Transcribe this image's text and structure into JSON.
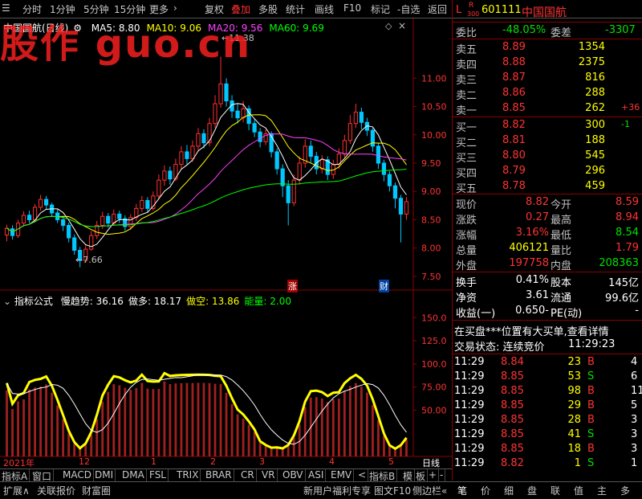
{
  "toolbar": {
    "left_items": [
      "分时",
      "1分钟",
      "5分钟",
      "15分钟",
      "更多"
    ],
    "right_items": [
      "复权",
      "叠加",
      "多股",
      "统计",
      "画线",
      "F10",
      "标记",
      "-自选",
      "返回"
    ],
    "active": "叠加"
  },
  "watermark": "股作 guo.cn",
  "kline": {
    "title": "中国国航(日线)",
    "ma_labels": [
      {
        "text": "MA5: 8.80",
        "color": "#ffffff"
      },
      {
        "text": "MA10: 9.06",
        "color": "#ffff00"
      },
      {
        "text": "MA20: 9.56",
        "color": "#ff40ff"
      },
      {
        "text": "MA60: 9.69",
        "color": "#00ff00"
      }
    ],
    "high_label": "11.38",
    "low_label": "7.66",
    "y_ticks": [
      "11.00",
      "10.50",
      "10.00",
      "9.50",
      "9.00",
      "8.50",
      "8.00",
      "7.50"
    ],
    "marker_zhang": "涨",
    "marker_cai": "财"
  },
  "indicator": {
    "title": "指标公式",
    "labels": [
      {
        "text": "慢趋势: 36.16",
        "color": "#ffffff"
      },
      {
        "text": "做多: 18.17",
        "color": "#ffffff"
      },
      {
        "text": "做空: 13.86",
        "color": "#ffff00"
      },
      {
        "text": "能量: 2.00",
        "color": "#00ff00"
      }
    ],
    "y_ticks": [
      "150.0",
      "125.0",
      "100.0",
      "75.00",
      "50.00"
    ]
  },
  "x_axis": {
    "labels": [
      "2021年",
      "12",
      "1",
      "2",
      "3",
      "4",
      "5"
    ],
    "period": "日线"
  },
  "chart_data": {
    "type": "line",
    "title": "",
    "candles": [
      [
        8.23,
        8.35,
        8.12,
        8.41
      ],
      [
        8.34,
        8.22,
        8.15,
        8.4
      ],
      [
        8.22,
        8.44,
        8.18,
        8.5
      ],
      [
        8.44,
        8.58,
        8.38,
        8.65
      ],
      [
        8.58,
        8.5,
        8.44,
        8.66
      ],
      [
        8.5,
        8.72,
        8.45,
        8.78
      ],
      [
        8.72,
        8.86,
        8.66,
        8.94
      ],
      [
        8.86,
        8.76,
        8.68,
        8.92
      ],
      [
        8.76,
        8.62,
        8.55,
        8.8
      ],
      [
        8.62,
        8.5,
        8.44,
        8.68
      ],
      [
        8.5,
        8.4,
        8.3,
        8.56
      ],
      [
        8.4,
        8.18,
        8.1,
        8.45
      ],
      [
        8.18,
        7.96,
        7.88,
        8.24
      ],
      [
        7.96,
        7.78,
        7.66,
        8.02
      ],
      [
        7.78,
        7.98,
        7.74,
        8.05
      ],
      [
        7.98,
        8.22,
        7.95,
        8.3
      ],
      [
        8.22,
        8.4,
        8.16,
        8.48
      ],
      [
        8.4,
        8.56,
        8.34,
        8.64
      ],
      [
        8.56,
        8.44,
        8.36,
        8.62
      ],
      [
        8.44,
        8.6,
        8.4,
        8.68
      ],
      [
        8.6,
        8.52,
        8.44,
        8.66
      ],
      [
        8.52,
        8.38,
        8.3,
        8.58
      ],
      [
        8.38,
        8.54,
        8.32,
        8.6
      ],
      [
        8.54,
        8.7,
        8.48,
        8.78
      ],
      [
        8.7,
        8.84,
        8.64,
        8.92
      ],
      [
        8.84,
        8.7,
        8.62,
        8.9
      ],
      [
        8.7,
        8.92,
        8.66,
        9.0
      ],
      [
        8.92,
        9.2,
        8.86,
        9.3
      ],
      [
        9.2,
        9.36,
        9.1,
        9.46
      ],
      [
        9.36,
        9.22,
        9.12,
        9.44
      ],
      [
        9.22,
        9.48,
        9.18,
        9.58
      ],
      [
        9.48,
        9.7,
        9.4,
        9.8
      ],
      [
        9.7,
        9.58,
        9.48,
        9.82
      ],
      [
        9.58,
        9.8,
        9.52,
        9.9
      ],
      [
        9.8,
        10.02,
        9.72,
        10.12
      ],
      [
        10.02,
        9.86,
        9.76,
        10.1
      ],
      [
        9.86,
        10.2,
        9.8,
        10.3
      ],
      [
        10.2,
        10.55,
        10.12,
        10.7
      ],
      [
        10.55,
        10.9,
        10.48,
        11.38
      ],
      [
        10.9,
        10.6,
        10.5,
        11.0
      ],
      [
        10.6,
        10.42,
        10.3,
        10.7
      ],
      [
        10.42,
        10.3,
        10.2,
        10.55
      ],
      [
        10.3,
        10.46,
        10.22,
        10.6
      ],
      [
        10.46,
        10.2,
        10.08,
        10.52
      ],
      [
        10.2,
        10.05,
        9.96,
        10.28
      ],
      [
        10.05,
        9.88,
        9.78,
        10.12
      ],
      [
        9.88,
        10.02,
        9.82,
        10.1
      ],
      [
        10.02,
        9.7,
        9.6,
        10.06
      ],
      [
        9.7,
        9.4,
        9.3,
        9.76
      ],
      [
        9.4,
        9.1,
        8.9,
        9.48
      ],
      [
        9.1,
        8.8,
        8.4,
        9.2
      ],
      [
        8.8,
        9.2,
        8.74,
        9.3
      ],
      [
        9.2,
        9.5,
        9.12,
        9.62
      ],
      [
        9.5,
        9.8,
        9.42,
        9.92
      ],
      [
        9.8,
        9.62,
        9.5,
        9.9
      ],
      [
        9.62,
        9.4,
        9.3,
        9.7
      ],
      [
        9.4,
        9.56,
        9.32,
        9.64
      ],
      [
        9.56,
        9.3,
        9.2,
        9.62
      ],
      [
        9.3,
        9.48,
        9.22,
        9.56
      ],
      [
        9.48,
        9.66,
        9.4,
        9.76
      ],
      [
        9.66,
        9.9,
        9.6,
        10.0
      ],
      [
        9.9,
        10.2,
        9.84,
        10.35
      ],
      [
        10.2,
        10.4,
        10.12,
        10.55
      ],
      [
        10.4,
        10.22,
        10.1,
        10.48
      ],
      [
        10.22,
        10.08,
        9.98,
        10.3
      ],
      [
        10.08,
        9.8,
        9.7,
        10.12
      ],
      [
        9.8,
        9.5,
        9.4,
        9.86
      ],
      [
        9.5,
        9.3,
        9.18,
        9.56
      ],
      [
        9.3,
        9.1,
        9.0,
        9.36
      ],
      [
        9.1,
        8.88,
        8.7,
        9.16
      ],
      [
        8.88,
        8.6,
        8.1,
        8.94
      ],
      [
        8.6,
        8.82,
        8.5,
        8.9
      ]
    ],
    "y_range": [
      7.3,
      11.8
    ],
    "indicator_range": [
      0,
      165
    ]
  },
  "quote": {
    "stock_code": "601111",
    "stock_name": "中国国航",
    "badge_l": "L",
    "badge_r": "R",
    "badge_300": "300",
    "weibi_label": "委比",
    "weibi_value": "-48.05%",
    "weicha_label": "委差",
    "weicha_value": "-3307",
    "sell": [
      {
        "label": "卖五",
        "price": "8.89",
        "vol": "1354",
        "chg": ""
      },
      {
        "label": "卖四",
        "price": "8.88",
        "vol": "2375",
        "chg": ""
      },
      {
        "label": "卖三",
        "price": "8.87",
        "vol": "816",
        "chg": ""
      },
      {
        "label": "卖二",
        "price": "8.86",
        "vol": "288",
        "chg": ""
      },
      {
        "label": "卖一",
        "price": "8.85",
        "vol": "262",
        "chg": "+36"
      }
    ],
    "buy": [
      {
        "label": "买一",
        "price": "8.82",
        "vol": "300",
        "chg": "-1"
      },
      {
        "label": "买二",
        "price": "8.81",
        "vol": "188",
        "chg": ""
      },
      {
        "label": "买三",
        "price": "8.80",
        "vol": "545",
        "chg": ""
      },
      {
        "label": "买四",
        "price": "8.79",
        "vol": "296",
        "chg": ""
      },
      {
        "label": "买五",
        "price": "8.78",
        "vol": "459",
        "chg": ""
      }
    ],
    "stats": [
      {
        "l1": "现价",
        "v1": "8.82",
        "c1": "red",
        "l2": "今开",
        "v2": "8.59",
        "c2": "red"
      },
      {
        "l1": "涨跌",
        "v1": "0.27",
        "c1": "red",
        "l2": "最高",
        "v2": "8.94",
        "c2": "red"
      },
      {
        "l1": "涨幅",
        "v1": "3.16%",
        "c1": "red",
        "l2": "最低",
        "v2": "8.54",
        "c2": "green"
      },
      {
        "l1": "总量",
        "v1": "406121",
        "c1": "yellow",
        "l2": "量比",
        "v2": "1.79",
        "c2": "red"
      },
      {
        "l1": "外盘",
        "v1": "197758",
        "c1": "red",
        "l2": "内盘",
        "v2": "208363",
        "c2": "green"
      }
    ],
    "stats2": [
      {
        "l1": "换手",
        "v1": "0.41%",
        "l2": "股本",
        "v2": "145亿"
      },
      {
        "l1": "净资",
        "v1": "3.61",
        "l2": "流通",
        "v2": "99.6亿"
      },
      {
        "l1": "收益(一)",
        "v1": "-0.650",
        "l2": "PE(动)",
        "v2": "-"
      }
    ],
    "notice": "在买盘***位置有大买单,查看详情",
    "trade_status_label": "交易状态: 连续竞价",
    "trade_status_time": "11:29:23",
    "ticks": [
      {
        "t": "11:29",
        "p": "8.84",
        "v": "23",
        "s": "B",
        "n": "4"
      },
      {
        "t": "11:29",
        "p": "8.85",
        "v": "53",
        "s": "S",
        "n": "6"
      },
      {
        "t": "11:29",
        "p": "8.85",
        "v": "98",
        "s": "B",
        "n": "11"
      },
      {
        "t": "11:29",
        "p": "8.85",
        "v": "29",
        "s": "B",
        "n": "5"
      },
      {
        "t": "11:29",
        "p": "8.85",
        "v": "28",
        "s": "B",
        "n": "3"
      },
      {
        "t": "11:29",
        "p": "8.85",
        "v": "41",
        "s": "S",
        "n": "3"
      },
      {
        "t": "11:29",
        "p": "8.85",
        "v": "18",
        "s": "B",
        "n": "3"
      },
      {
        "t": "11:29",
        "p": "8.82",
        "v": "1",
        "s": "S",
        "n": "1"
      }
    ]
  },
  "indicator_tabs": [
    "指标A",
    "窗口",
    "MACD",
    "DMI",
    "DMA",
    "FSL",
    "TRIX",
    "BRAR",
    "CR",
    "VR",
    "OBV",
    "ASI",
    "EMV",
    "<",
    "指标B",
    "模",
    "板",
    "+",
    "-"
  ],
  "bottom_tabs_left": [
    "扩展∧",
    "关联报价",
    "财富圈"
  ],
  "bottom_tabs_mid": [
    "新用户福利专享",
    "图文F10",
    "侧边栏«"
  ],
  "bottom_tabs_right": [
    "笔",
    "价",
    "细",
    "盘",
    "联",
    "值",
    "主",
    "多"
  ]
}
